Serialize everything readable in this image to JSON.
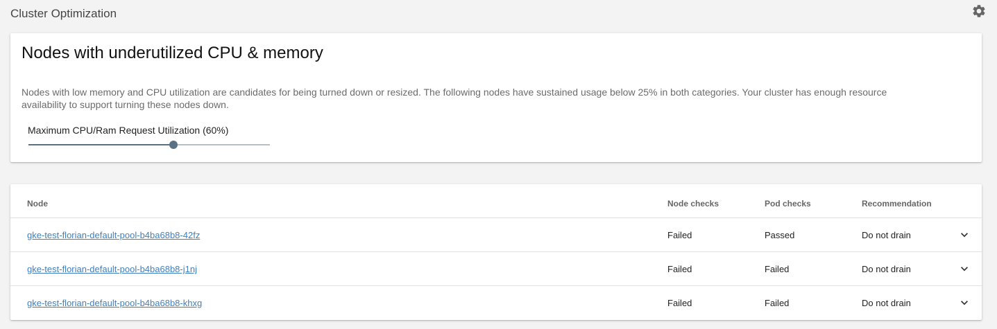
{
  "page": {
    "title": "Cluster Optimization",
    "settings_icon": "gear-icon"
  },
  "summary": {
    "title": "Nodes with underutilized CPU & memory",
    "description": "Nodes with low memory and CPU utilization are candidates for being turned down or resized. The following nodes have sustained usage below 25% in both categories. Your cluster has enough resource availability to support turning these nodes down.",
    "slider_label": "Maximum CPU/Ram Request Utilization (60%)",
    "slider_value": 0.6
  },
  "table": {
    "headers": {
      "node": "Node",
      "node_checks": "Node checks",
      "pod_checks": "Pod checks",
      "recommendation": "Recommendation"
    },
    "rows": [
      {
        "node": "gke-test-florian-default-pool-b4ba68b8-42fz",
        "node_checks": "Failed",
        "pod_checks": "Passed",
        "recommendation": "Do not drain"
      },
      {
        "node": "gke-test-florian-default-pool-b4ba68b8-j1nj",
        "node_checks": "Failed",
        "pod_checks": "Failed",
        "recommendation": "Do not drain"
      },
      {
        "node": "gke-test-florian-default-pool-b4ba68b8-khxg",
        "node_checks": "Failed",
        "pod_checks": "Failed",
        "recommendation": "Do not drain"
      }
    ],
    "expand_icon": "chevron-down-icon"
  },
  "colors": {
    "accent": "#5a7184",
    "link": "#3f7fbf",
    "background": "#f3f3f3"
  }
}
